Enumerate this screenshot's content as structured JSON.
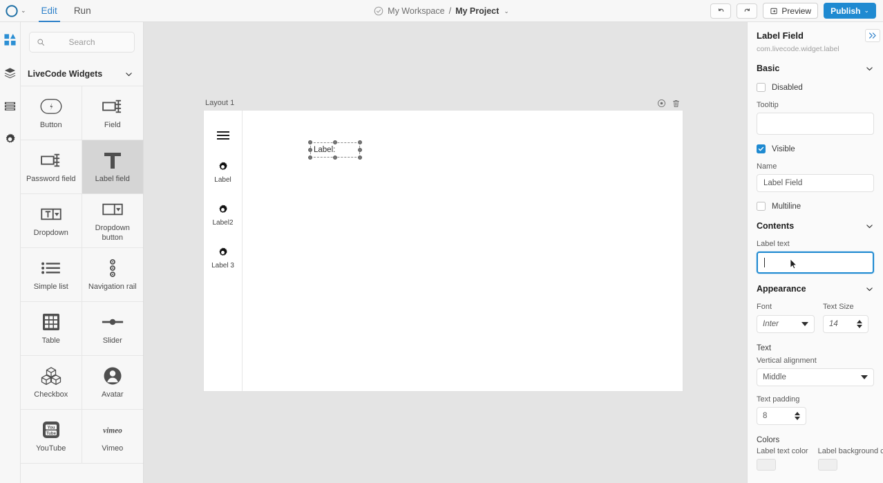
{
  "topbar": {
    "logo_icon": "livecode-logo-icon",
    "brand_caret": "⌄",
    "tabs": [
      {
        "label": "Edit",
        "active": true
      },
      {
        "label": "Run",
        "active": false
      }
    ],
    "breadcrumb": {
      "status_icon": "check-circle-icon",
      "workspace": "My Workspace",
      "separator": "/",
      "project": "My Project",
      "caret": "⌄"
    },
    "undo_icon": "undo-icon",
    "redo_icon": "redo-icon",
    "preview_label": "Preview",
    "preview_icon": "preview-icon",
    "publish_label": "Publish",
    "publish_caret": "⌄",
    "accent_color": "#1f8ad1"
  },
  "rail": {
    "items": [
      {
        "icon": "widgets-grid-icon",
        "active": true
      },
      {
        "icon": "layers-icon",
        "active": false
      },
      {
        "icon": "list-icon",
        "active": false
      },
      {
        "icon": "gear-icon",
        "active": false
      }
    ]
  },
  "widgets_panel": {
    "search": {
      "placeholder": "Search",
      "value": "",
      "icon": "search-icon"
    },
    "group": {
      "title": "LiveCode Widgets",
      "chevron": "chevron-down-icon",
      "expanded": true
    },
    "items": [
      {
        "label": "Button",
        "icon": "button-icon",
        "selected": false
      },
      {
        "label": "Field",
        "icon": "field-icon",
        "selected": false
      },
      {
        "label": "Password field",
        "icon": "password-field-icon",
        "selected": false
      },
      {
        "label": "Label field",
        "icon": "label-field-icon",
        "selected": true
      },
      {
        "label": "Dropdown",
        "icon": "dropdown-icon",
        "selected": false
      },
      {
        "label": "Dropdown button",
        "icon": "dropdown-button-icon",
        "selected": false
      },
      {
        "label": "Simple list",
        "icon": "simple-list-icon",
        "selected": false
      },
      {
        "label": "Navigation rail",
        "icon": "navigation-rail-icon",
        "selected": false
      },
      {
        "label": "Table",
        "icon": "table-icon",
        "selected": false
      },
      {
        "label": "Slider",
        "icon": "slider-icon",
        "selected": false
      },
      {
        "label": "Checkbox",
        "icon": "checkbox-icon",
        "selected": false
      },
      {
        "label": "Avatar",
        "icon": "avatar-icon",
        "selected": false
      },
      {
        "label": "YouTube",
        "icon": "youtube-icon",
        "selected": false
      },
      {
        "label": "Vimeo",
        "icon": "vimeo-icon",
        "selected": false
      }
    ]
  },
  "canvas": {
    "layout_title": "Layout 1",
    "tools": [
      {
        "icon": "target-record-icon"
      },
      {
        "icon": "trash-icon"
      }
    ],
    "navrail": {
      "menu_icon": "hamburger-menu-icon",
      "items": [
        {
          "label": "Label",
          "icon": "gear-icon"
        },
        {
          "label": "Label2",
          "icon": "gear-icon"
        },
        {
          "label": "Label 3",
          "icon": "gear-icon"
        }
      ]
    },
    "selected_widget": {
      "text": "Label:",
      "handles": 8
    }
  },
  "properties": {
    "title": "Label Field",
    "subtitle": "com.livecode.widget.label",
    "collapse_icon": "chevron-double-right-icon",
    "sections": {
      "basic": {
        "title": "Basic",
        "chevron": "chevron-down-icon",
        "disabled": {
          "label": "Disabled",
          "checked": false
        },
        "tooltip": {
          "label": "Tooltip",
          "value": ""
        },
        "visible": {
          "label": "Visible",
          "checked": true
        },
        "name": {
          "label": "Name",
          "value": "Label Field"
        },
        "multiline": {
          "label": "Multiline",
          "checked": false
        }
      },
      "contents": {
        "title": "Contents",
        "chevron": "chevron-down-icon",
        "label_text": {
          "label": "Label text",
          "value": "",
          "focused": true
        }
      },
      "appearance": {
        "title": "Appearance",
        "chevron": "chevron-down-icon",
        "font": {
          "label": "Font",
          "value": "Inter"
        },
        "text_size": {
          "label": "Text Size",
          "value": "14"
        },
        "text_group_label": "Text",
        "vertical_alignment": {
          "label": "Vertical alignment",
          "value": "Middle"
        },
        "text_padding": {
          "label": "Text padding",
          "value": "8"
        }
      },
      "colors": {
        "title": "Colors",
        "label_text_color": {
          "label": "Label text color",
          "swatch": "#efefef"
        },
        "label_background_color": {
          "label": "Label background c",
          "swatch": "#efefef"
        }
      }
    }
  }
}
